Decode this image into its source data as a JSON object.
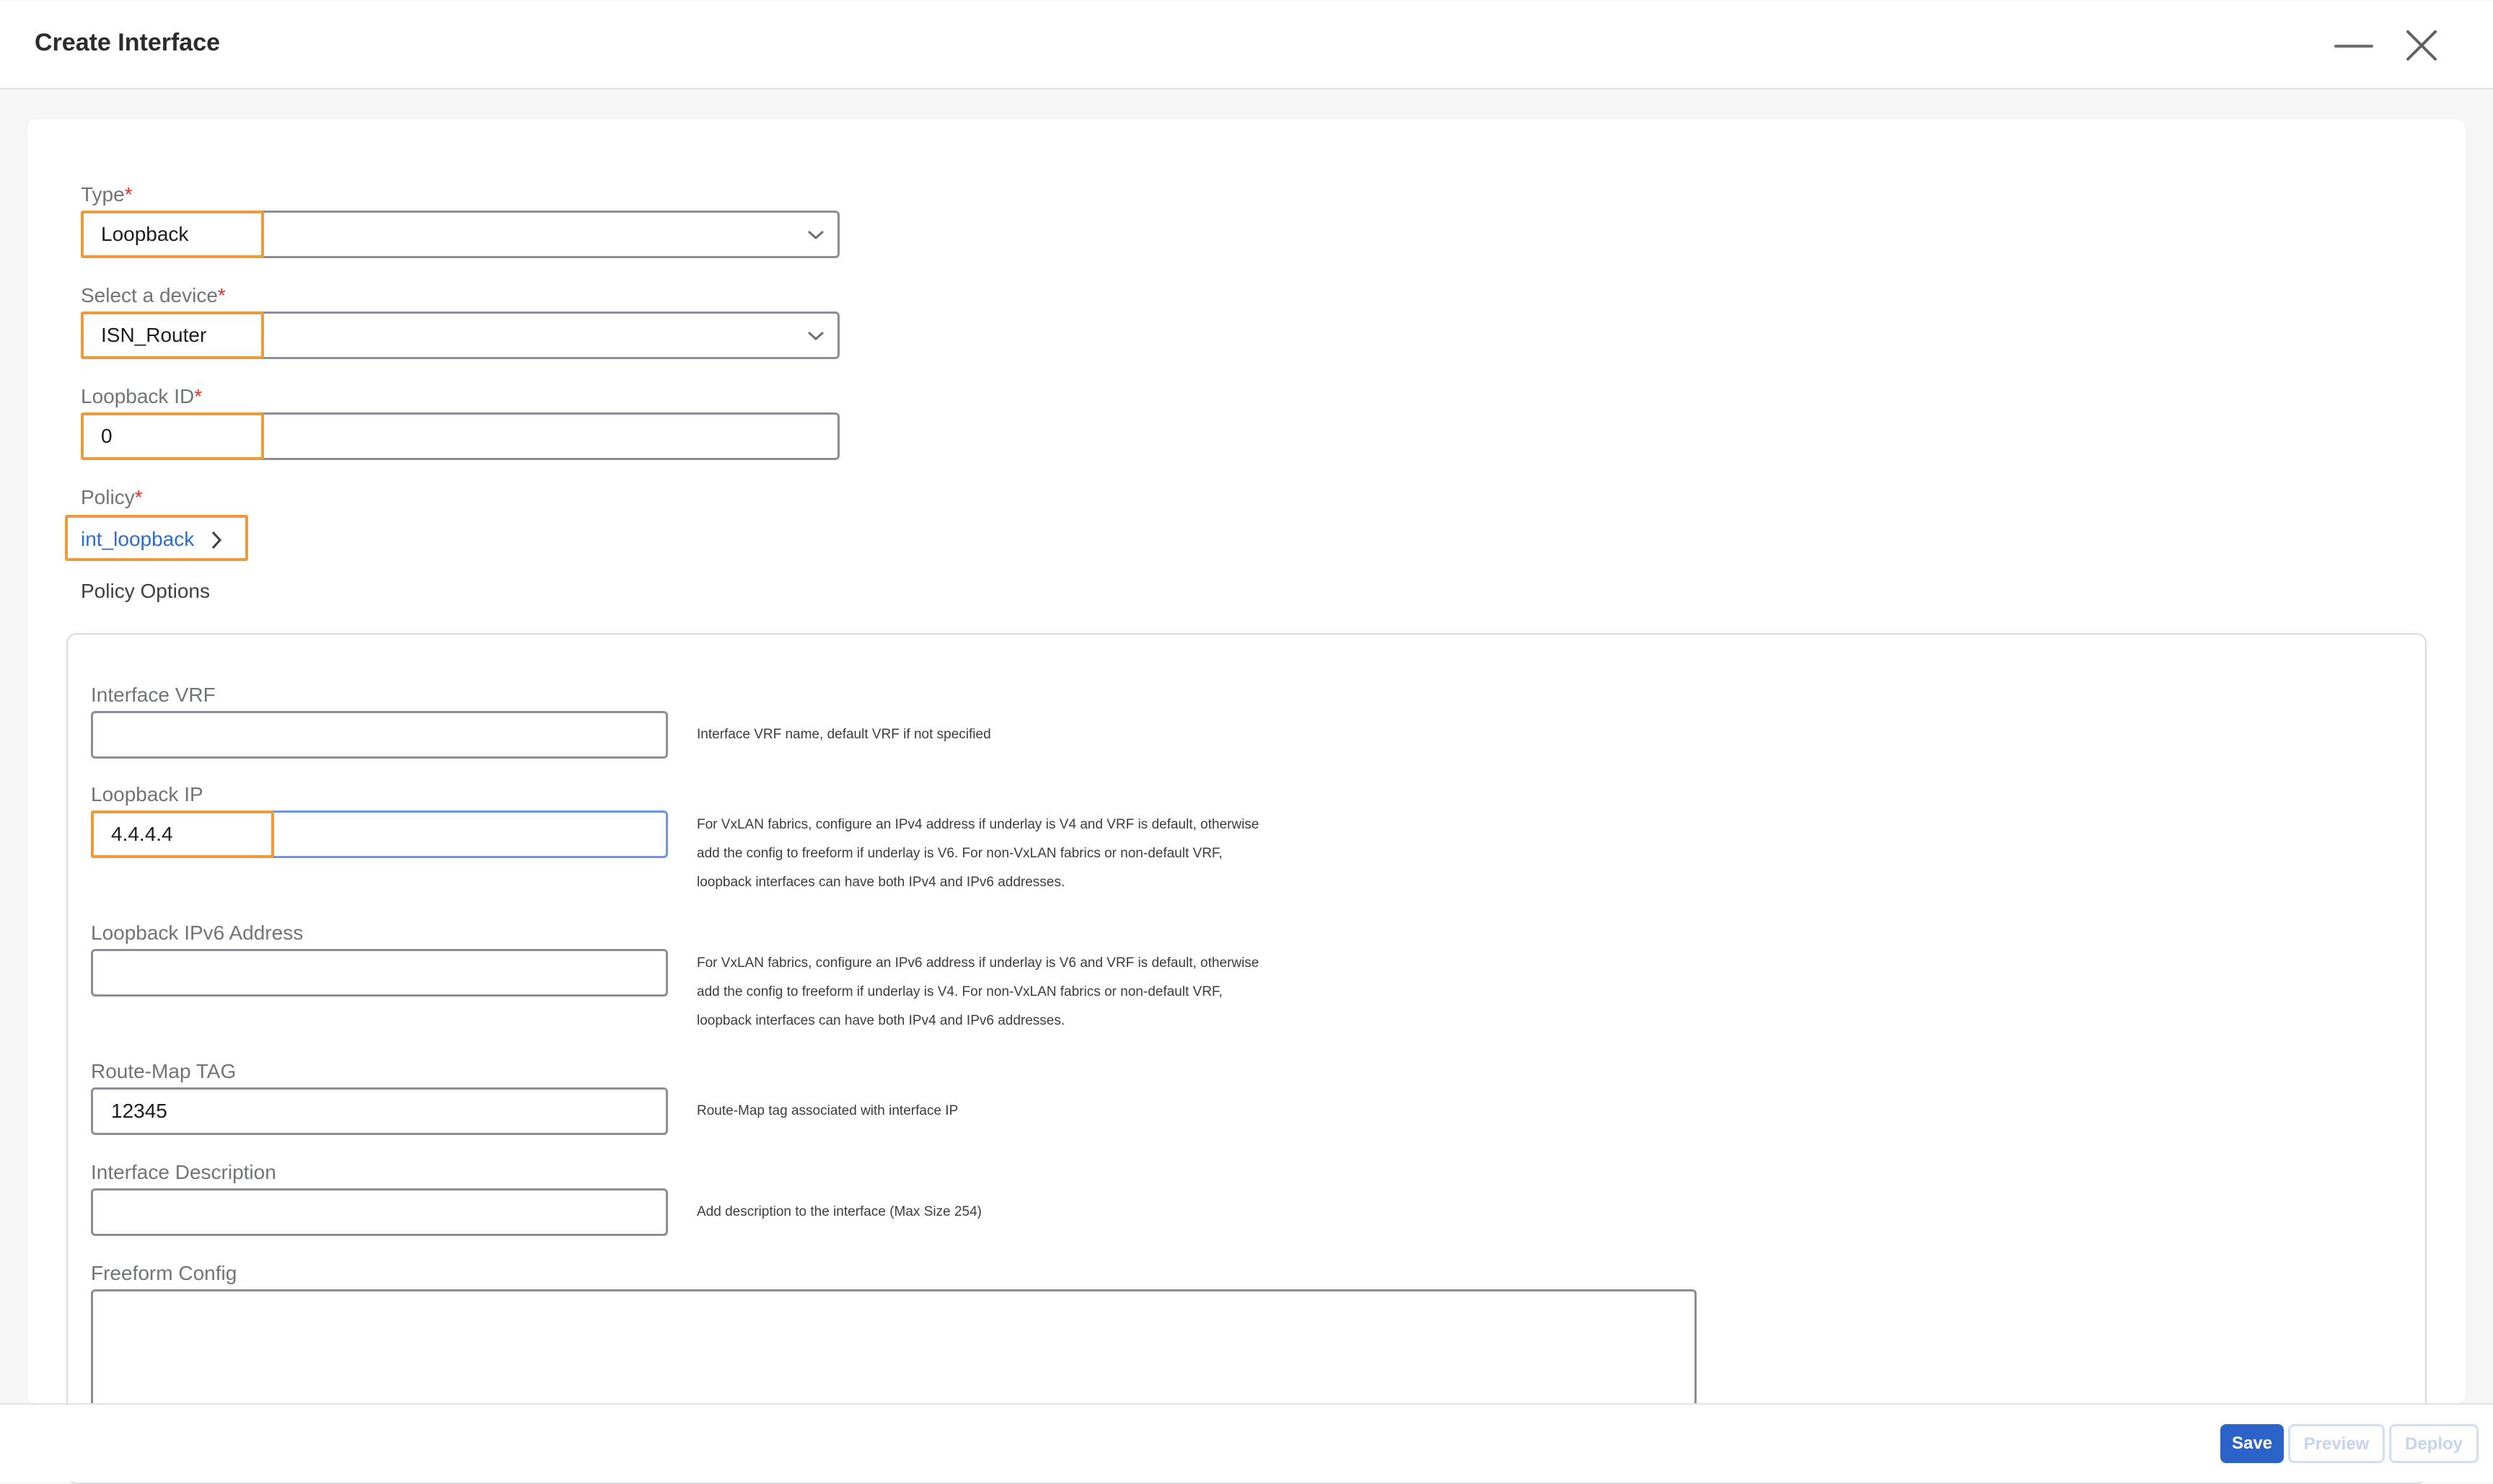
{
  "dialog": {
    "title": "Create Interface"
  },
  "form": {
    "type": {
      "label": "Type",
      "value": "Loopback"
    },
    "device": {
      "label": "Select a device",
      "value": "ISN_Router"
    },
    "loopback_id": {
      "label": "Loopback ID",
      "value": "0"
    },
    "policy": {
      "label": "Policy",
      "value": "int_loopback"
    },
    "policy_options_label": "Policy Options",
    "required_marker": "*"
  },
  "policy_options": {
    "interface_vrf": {
      "label": "Interface VRF",
      "value": "",
      "help": [
        "Interface VRF name, default VRF if not specified"
      ]
    },
    "loopback_ip": {
      "label": "Loopback IP",
      "value": "4.4.4.4",
      "help": [
        "For VxLAN fabrics, configure an IPv4 address if underlay is V4 and VRF is default, otherwise",
        "add the config to freeform if underlay is V6. For non-VxLAN fabrics or non-default VRF,",
        "loopback interfaces can have both IPv4 and IPv6 addresses."
      ]
    },
    "loopback_ipv6": {
      "label": "Loopback IPv6 Address",
      "value": "",
      "help": [
        "For VxLAN fabrics, configure an IPv6 address if underlay is V6 and VRF is default, otherwise",
        "add the config to freeform if underlay is V4. For non-VxLAN fabrics or non-default VRF,",
        "loopback interfaces can have both IPv4 and IPv6 addresses."
      ]
    },
    "route_map_tag": {
      "label": "Route-Map TAG",
      "value": "12345",
      "help": [
        "Route-Map tag associated with interface IP"
      ]
    },
    "interface_description": {
      "label": "Interface Description",
      "value": "",
      "help": [
        "Add description to the interface (Max Size 254)"
      ]
    },
    "freeform_config": {
      "label": "Freeform Config",
      "value": ""
    }
  },
  "footer": {
    "save_label": "Save",
    "preview_label": "Preview",
    "deploy_label": "Deploy"
  },
  "colors": {
    "primary": "#2c63c9",
    "highlight": "#eb9b3c",
    "required": "#e0322b",
    "link": "#2d6ad1"
  },
  "icons": {
    "minimize": "minimize-icon",
    "close": "close-icon",
    "dropdown": "chevron-down-icon",
    "policy_link": "chevron-right-icon"
  }
}
